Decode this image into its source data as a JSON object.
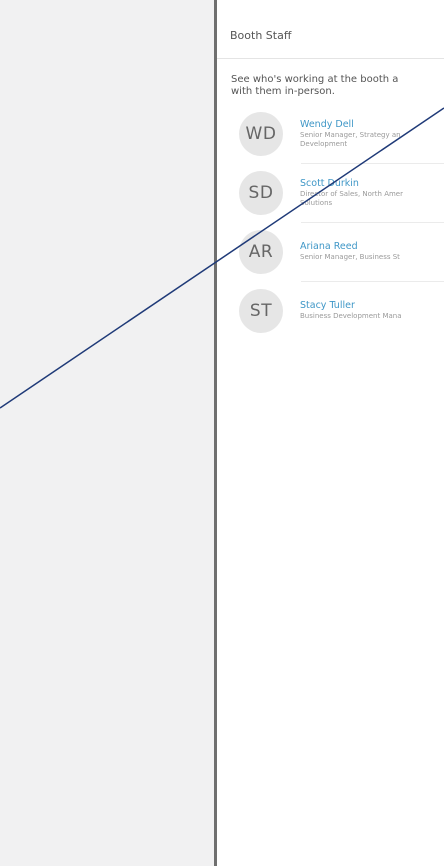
{
  "panel": {
    "title": "Booth Staff",
    "description_lines": [
      "See who's working at the booth a",
      "with them in-person."
    ]
  },
  "staff": [
    {
      "initials": "WD",
      "name": "Wendy Dell",
      "role_lines": [
        "Senior Manager, Strategy an",
        "Development"
      ]
    },
    {
      "initials": "SD",
      "name": "Scott Durkin",
      "role_lines": [
        "Director of Sales, North Amer",
        "Solutions"
      ]
    },
    {
      "initials": "AR",
      "name": "Ariana Reed",
      "role_lines": [
        "Senior Manager, Business St"
      ]
    },
    {
      "initials": "ST",
      "name": "Stacy Tuller",
      "role_lines": [
        "Business Development Mana"
      ]
    }
  ],
  "colors": {
    "left_pane": "#f1f1f2",
    "divider": "#6f6f6f",
    "name_link": "#3f97c7",
    "annotation_line": "#1f3a78"
  }
}
